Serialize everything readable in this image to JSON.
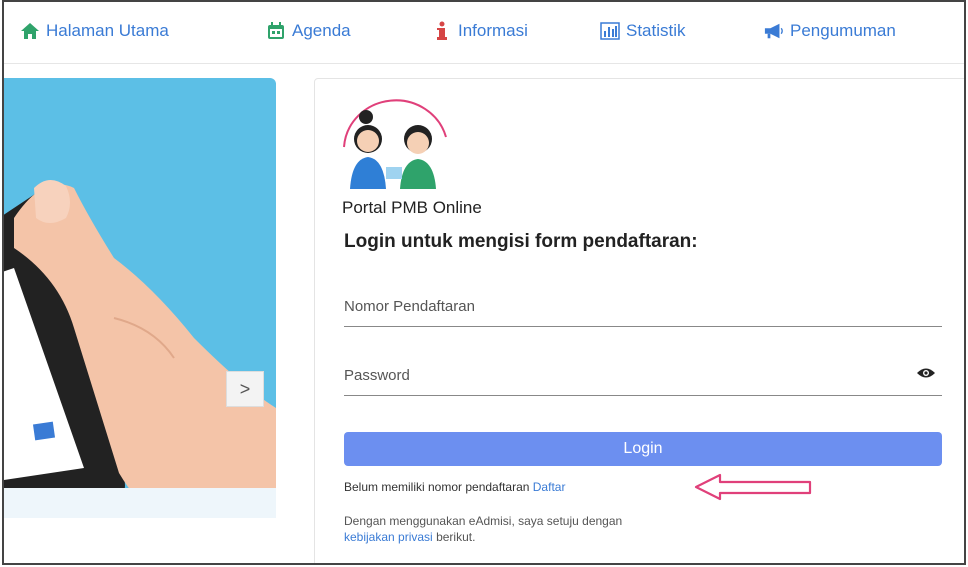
{
  "nav": {
    "items": [
      {
        "label": "Halaman Utama",
        "icon": "home-icon"
      },
      {
        "label": "Agenda",
        "icon": "calendar-icon"
      },
      {
        "label": "Informasi",
        "icon": "info-icon"
      },
      {
        "label": "Statistik",
        "icon": "bar-chart-icon"
      },
      {
        "label": "Pengumuman",
        "icon": "megaphone-icon"
      }
    ]
  },
  "hero": {
    "next_label": ">"
  },
  "login": {
    "portal_title": "Portal PMB Online",
    "heading": "Login untuk mengisi form pendaftaran:",
    "nomor_placeholder": "Nomor Pendaftaran",
    "password_placeholder": "Password",
    "button_label": "Login",
    "register_text": "Belum memiliki nomor pendaftaran",
    "register_link": "Daftar",
    "policy_text": "Dengan menggunakan eAdmisi, saya setuju dengan",
    "policy_link": "kebijakan privasi",
    "policy_suffix": "berikut."
  },
  "colors": {
    "accent": "#3a7bd5",
    "button": "#6c8ff0",
    "hero_bg": "#5cbfe6",
    "annotation_arrow": "#e0407a"
  }
}
